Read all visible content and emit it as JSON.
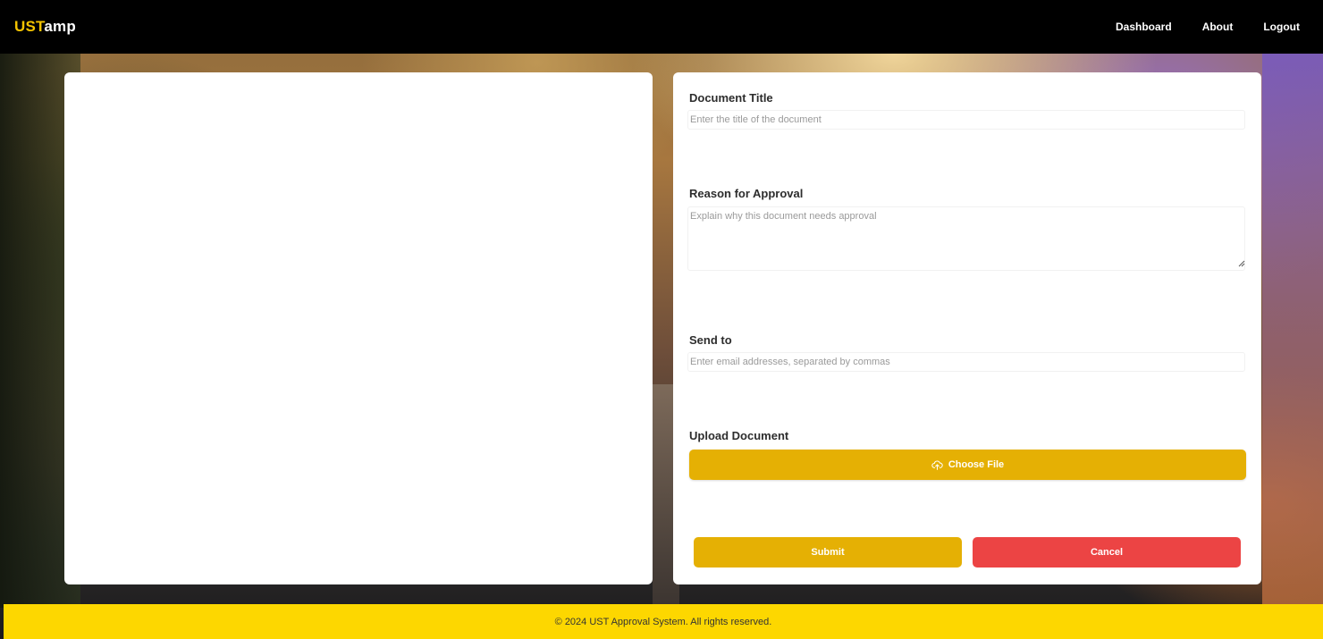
{
  "header": {
    "brand_accent": "UST",
    "brand_rest": "amp",
    "nav": {
      "dashboard": "Dashboard",
      "about": "About",
      "logout": "Logout"
    }
  },
  "form": {
    "title_label": "Document Title",
    "title_placeholder": "Enter the title of the document",
    "reason_label": "Reason for Approval",
    "reason_placeholder": "Explain why this document needs approval",
    "send_label": "Send to",
    "send_placeholder": "Enter email addresses, separated by commas",
    "upload_label": "Upload Document",
    "choose_file_label": "Choose File",
    "submit_label": "Submit",
    "cancel_label": "Cancel"
  },
  "footer": {
    "text": "© 2024 UST Approval System. All rights reserved."
  },
  "colors": {
    "brand_accent": "#f5c400",
    "primary": "#e5b004",
    "danger": "#ec4444",
    "footer": "#fdd700",
    "navbar": "#000000"
  },
  "icons": {
    "upload": "cloud-upload-icon"
  }
}
